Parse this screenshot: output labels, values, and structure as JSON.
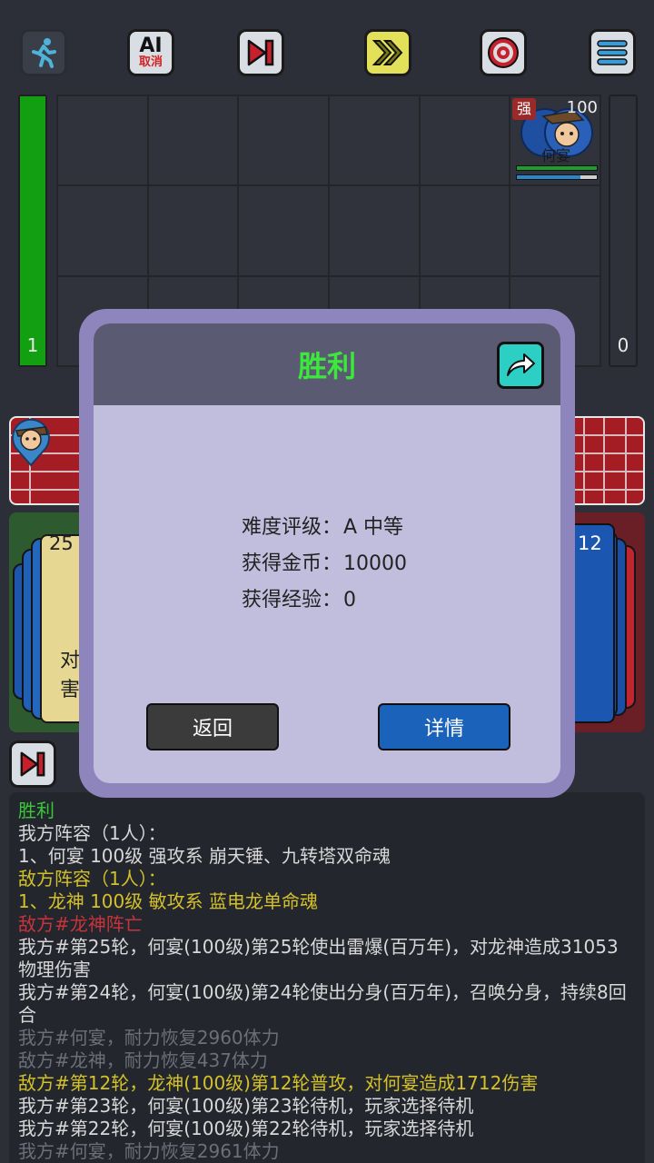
{
  "toolbar": {
    "ai_top": "AI",
    "ai_bottom": "取消"
  },
  "left_bar": {
    "value": "1",
    "fill_fraction": 1.0
  },
  "right_bar": {
    "value": "0"
  },
  "enemy_unit": {
    "tag": "强",
    "level": "100",
    "name": "何宴",
    "hp_fraction": 1.0,
    "mp_fraction": 0.8
  },
  "my_card": {
    "cost": "25",
    "text_line1": "对",
    "text_line2": "害"
  },
  "enemy_card": {
    "count": "12"
  },
  "dialog": {
    "title": "胜利",
    "rows": [
      {
        "label": "难度评级：",
        "value": "A 中等"
      },
      {
        "label": "获得金币：",
        "value": "10000"
      },
      {
        "label": "获得经验：",
        "value": "0"
      }
    ],
    "back_label": "返回",
    "detail_label": "详情"
  },
  "log": [
    {
      "text": "胜利",
      "color": "#3ac83a"
    },
    {
      "text": "我方阵容（1人）：",
      "color": "#d8d8d8"
    },
    {
      "text": "1、何宴 100级 强攻系 崩天锤、九转塔双命魂",
      "color": "#d8d8d8"
    },
    {
      "text": "敌方阵容（1人）：",
      "color": "#d4c12a"
    },
    {
      "text": "1、龙神 100级 敏攻系 蓝电龙单命魂",
      "color": "#d4c12a"
    },
    {
      "text": "敌方#龙神阵亡",
      "color": "#c8343a"
    },
    {
      "text": "我方#第25轮，何宴(100级)第25轮使出雷爆(百万年)，对龙神造成31053物理伤害",
      "color": "#d8d8d8"
    },
    {
      "text": "我方#第24轮，何宴(100级)第24轮使出分身(百万年)，召唤分身，持续8回合",
      "color": "#d8d8d8"
    },
    {
      "text": "我方#何宴，耐力恢复2960体力",
      "color": "#6c6f78"
    },
    {
      "text": "敌方#龙神，耐力恢复437体力",
      "color": "#6c6f78"
    },
    {
      "text": "敌方#第12轮，龙神(100级)第12轮普攻，对何宴造成1712伤害",
      "color": "#d4c12a"
    },
    {
      "text": "我方#第23轮，何宴(100级)第23轮待机，玩家选择待机",
      "color": "#d8d8d8"
    },
    {
      "text": "我方#第22轮，何宴(100级)第22轮待机，玩家选择待机",
      "color": "#d8d8d8"
    },
    {
      "text": "我方#何宴，耐力恢复2961体力",
      "color": "#6c6f78"
    }
  ]
}
